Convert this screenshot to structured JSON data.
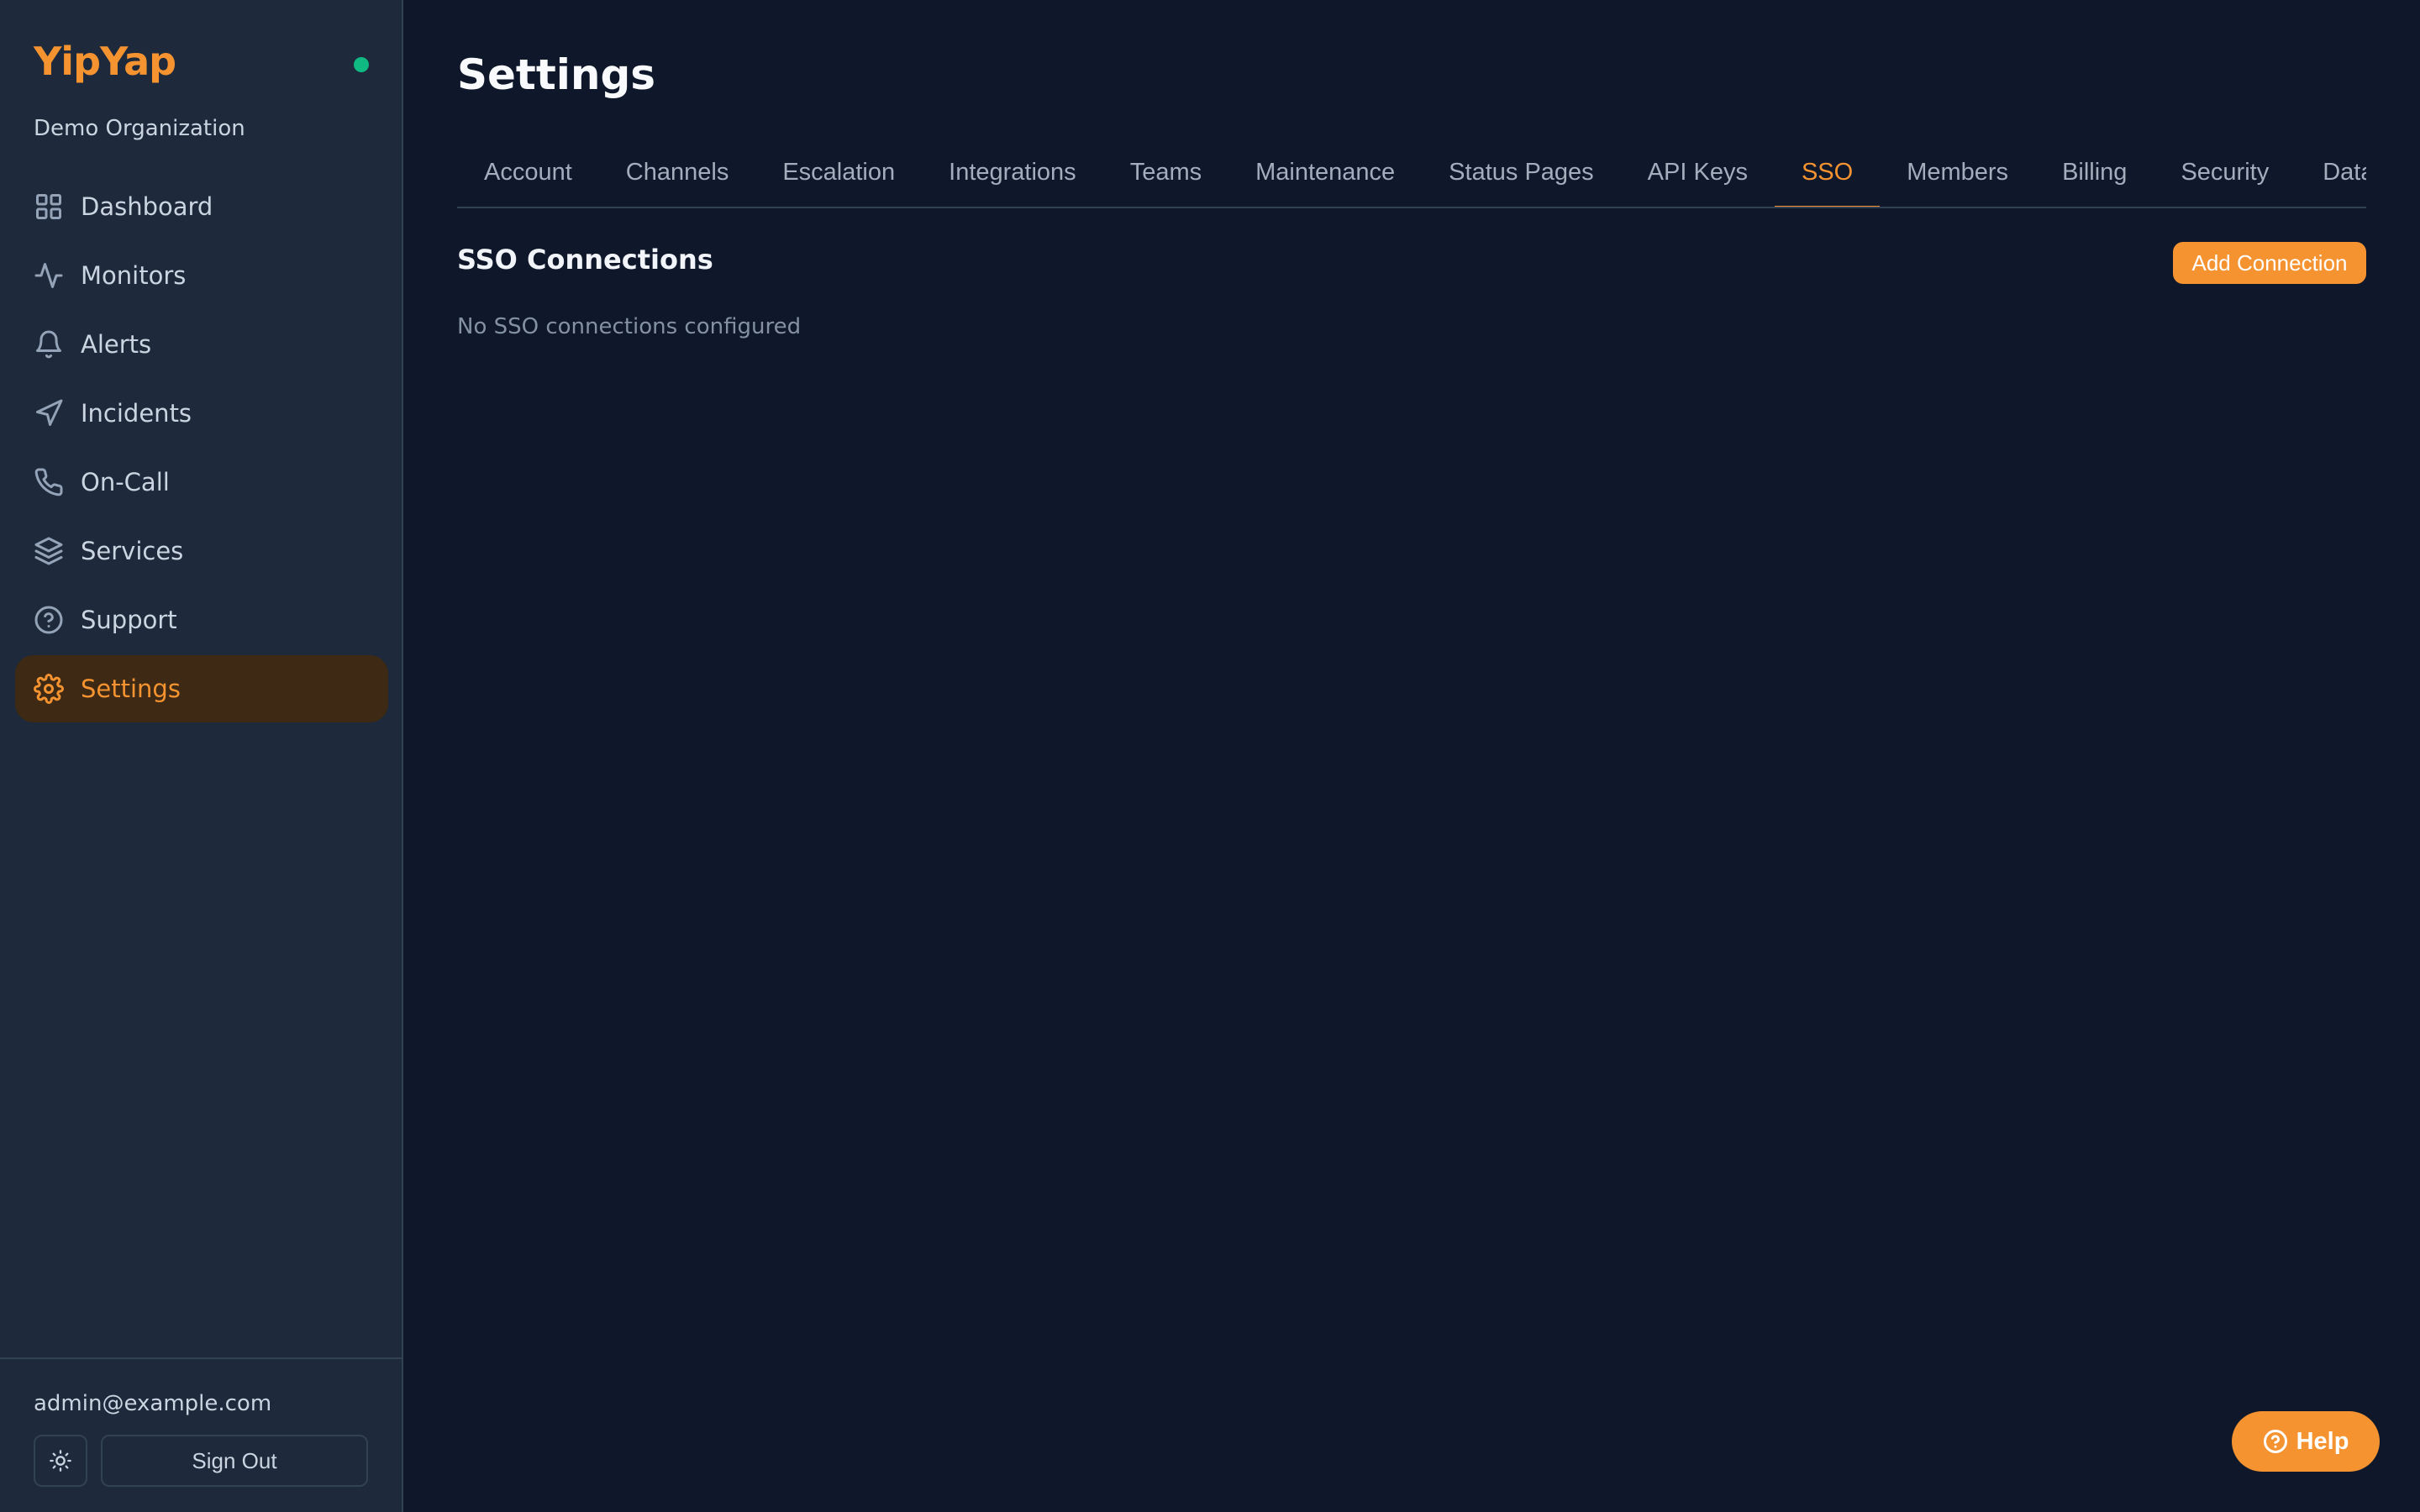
{
  "sidebar": {
    "brand": "YipYap",
    "organization": "Demo Organization",
    "items": [
      {
        "label": "Dashboard",
        "icon": "grid-icon"
      },
      {
        "label": "Monitors",
        "icon": "activity-icon"
      },
      {
        "label": "Alerts",
        "icon": "bell-icon"
      },
      {
        "label": "Incidents",
        "icon": "navigation-icon"
      },
      {
        "label": "On-Call",
        "icon": "phone-icon"
      },
      {
        "label": "Services",
        "icon": "layers-icon"
      },
      {
        "label": "Support",
        "icon": "help-circle-icon"
      },
      {
        "label": "Settings",
        "icon": "gear-icon",
        "active": true
      }
    ],
    "footer": {
      "email": "admin@example.com",
      "sign_out_label": "Sign Out",
      "theme_icon": "sun-icon"
    }
  },
  "main": {
    "title": "Settings",
    "tabs": [
      {
        "label": "Account"
      },
      {
        "label": "Channels"
      },
      {
        "label": "Escalation"
      },
      {
        "label": "Integrations"
      },
      {
        "label": "Teams"
      },
      {
        "label": "Maintenance"
      },
      {
        "label": "Status Pages"
      },
      {
        "label": "API Keys"
      },
      {
        "label": "SSO",
        "active": true
      },
      {
        "label": "Members"
      },
      {
        "label": "Billing"
      },
      {
        "label": "Security"
      },
      {
        "label": "Data"
      }
    ],
    "section": {
      "title": "SSO Connections",
      "add_button_label": "Add Connection",
      "empty_message": "No SSO connections configured"
    }
  },
  "help_button": {
    "label": "Help",
    "icon": "help-circle-icon"
  },
  "colors": {
    "accent": "#f59331",
    "background": "#0f172a",
    "sidebar": "#1e293b",
    "status_online": "#10b981"
  }
}
